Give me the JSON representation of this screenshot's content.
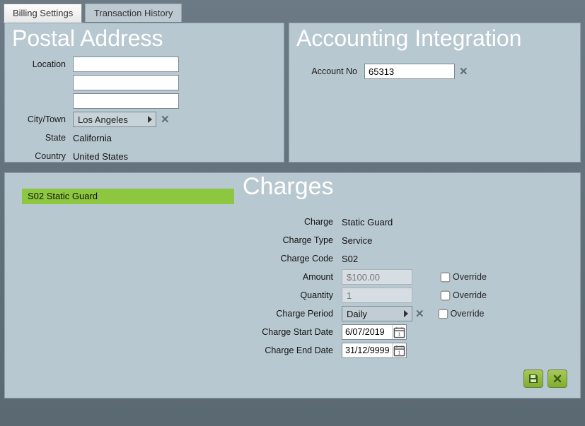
{
  "tabs": {
    "billing": "Billing Settings",
    "history": "Transaction History",
    "active": "billing"
  },
  "postal": {
    "title": "Postal Address",
    "labels": {
      "location": "Location",
      "city": "City/Town",
      "state": "State",
      "country": "Country"
    },
    "location1": "",
    "location2": "",
    "location3": "",
    "city": "Los Angeles",
    "state": "California",
    "country": "United States"
  },
  "accounting": {
    "title": "Accounting Integration",
    "labels": {
      "account_no": "Account No"
    },
    "account_no": "65313"
  },
  "selected_item": "S02 Static Guard",
  "charges": {
    "title": "Charges",
    "labels": {
      "charge": "Charge",
      "type": "Charge Type",
      "code": "Charge Code",
      "amount": "Amount",
      "qty": "Quantity",
      "period": "Charge Period",
      "start": "Charge Start Date",
      "end": "Charge End Date",
      "override": "Override"
    },
    "charge": "Static Guard",
    "type": "Service",
    "code": "S02",
    "amount": "$100.00",
    "quantity": "1",
    "period": "Daily",
    "start": "6/07/2019",
    "end": "31/12/9999",
    "override_amount": false,
    "override_qty": false,
    "override_period": false
  }
}
